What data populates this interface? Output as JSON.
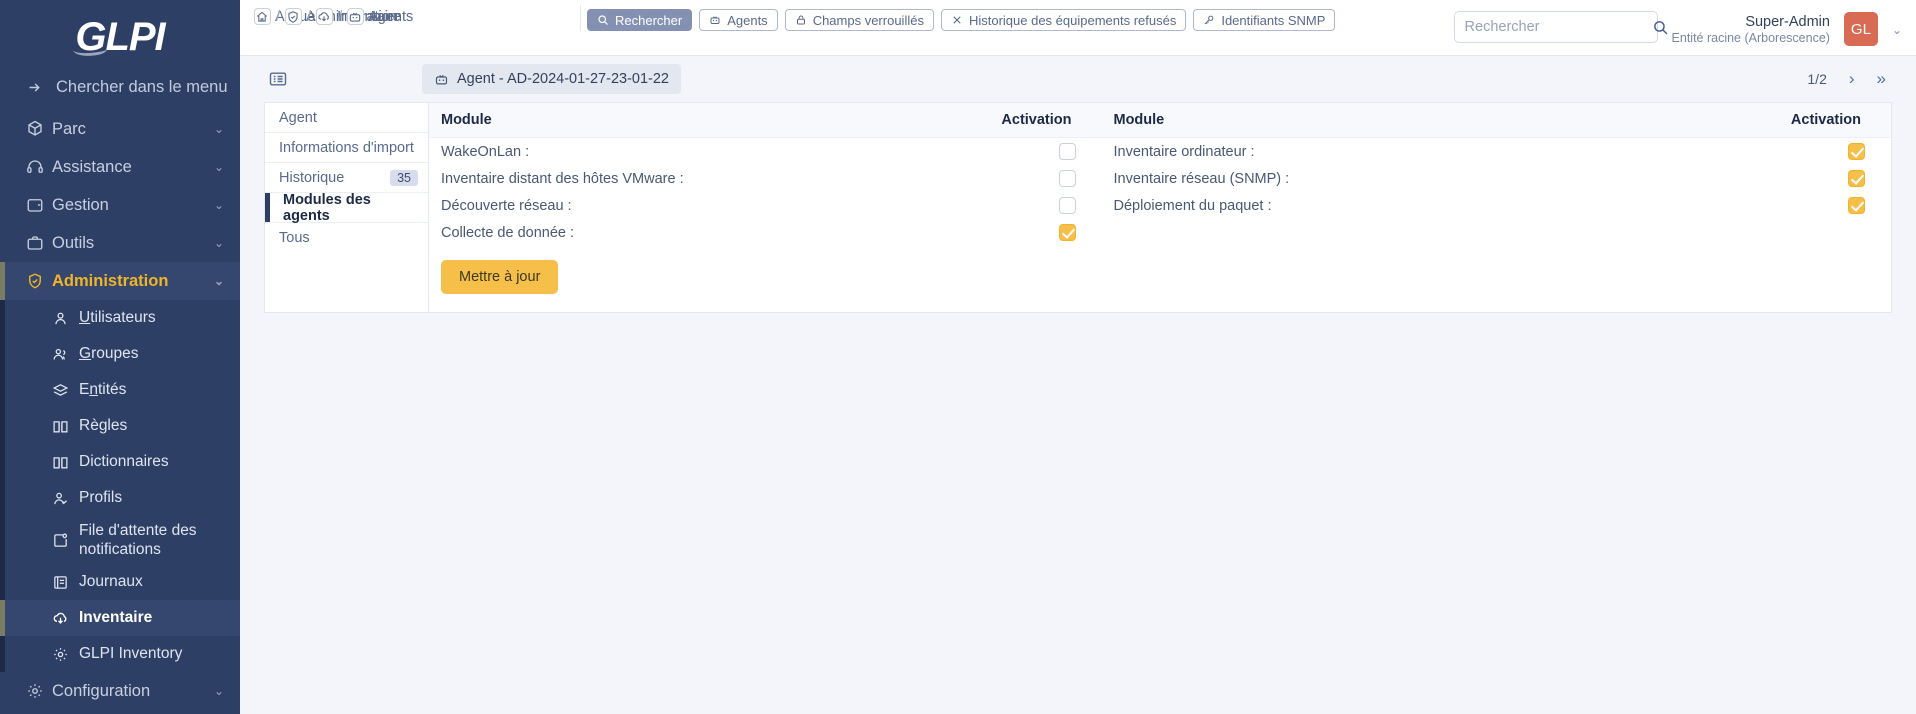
{
  "sidebar": {
    "logo": "GLPI",
    "menu_search_label": "Chercher dans le menu",
    "top_items": [
      {
        "label": "Parc",
        "icon": "box-icon"
      },
      {
        "label": "Assistance",
        "icon": "headset-icon"
      },
      {
        "label": "Gestion",
        "icon": "wallet-icon"
      },
      {
        "label": "Outils",
        "icon": "briefcase-icon"
      }
    ],
    "active_parent": {
      "label": "Administration",
      "icon": "shield-icon"
    },
    "sub_items": [
      {
        "label": "Utilisateurs",
        "accel": "U",
        "icon": "user-icon"
      },
      {
        "label": "Groupes",
        "accel": "G",
        "icon": "users-icon"
      },
      {
        "label": "Entités",
        "accel": "n",
        "icon": "layers-icon"
      },
      {
        "label": "Règles",
        "accel": "",
        "icon": "book-icon"
      },
      {
        "label": "Dictionnaires",
        "accel": "",
        "icon": "book-icon"
      },
      {
        "label": "Profils",
        "accel": "",
        "icon": "user-check-icon"
      },
      {
        "label": "File d'attente des notifications",
        "accel": "",
        "icon": "notification-icon"
      },
      {
        "label": "Journaux",
        "accel": "",
        "icon": "journal-icon"
      },
      {
        "label": "Inventaire",
        "accel": "",
        "icon": "cloud-download-icon",
        "current": true
      },
      {
        "label": "GLPI Inventory",
        "accel": "",
        "icon": "gear-icon"
      }
    ],
    "bottom_item": {
      "label": "Configuration",
      "icon": "gear-icon"
    }
  },
  "header": {
    "breadcrumb": [
      {
        "label": "Accueil",
        "icon": "home-icon"
      },
      {
        "label": "Administration",
        "icon": "shield-icon"
      },
      {
        "label": "Inventaire",
        "icon": "cloud-download-icon"
      },
      {
        "label": "Agents",
        "icon": "robot-icon"
      }
    ],
    "separator": "/",
    "pills": [
      {
        "label": "Rechercher",
        "icon": "search-icon",
        "active": true
      },
      {
        "label": "Agents",
        "icon": "robot-icon",
        "active": false
      },
      {
        "label": "Champs verrouillés",
        "icon": "lock-icon",
        "active": false
      },
      {
        "label": "Historique des équipements refusés",
        "icon": "close-icon",
        "active": false
      },
      {
        "label": "Identifiants SNMP",
        "icon": "key-icon",
        "active": false
      }
    ],
    "search": {
      "placeholder": "Rechercher",
      "value": ""
    },
    "user": {
      "name": "Super-Admin",
      "entity": "Entité racine (Arborescence)",
      "initials": "GL"
    }
  },
  "title_row": {
    "agent_label": "Agent - AD-2024-01-27-23-01-22",
    "pager": {
      "count": "1/2",
      "next": "›",
      "last": "»"
    }
  },
  "tabs": [
    {
      "label": "Agent",
      "badge": "",
      "active": false
    },
    {
      "label": "Informations d'import",
      "badge": "",
      "active": false
    },
    {
      "label": "Historique",
      "badge": "35",
      "active": false
    },
    {
      "label": "Modules des agents",
      "badge": "",
      "active": true
    },
    {
      "label": "Tous",
      "badge": "",
      "active": false
    }
  ],
  "modules_table": {
    "headers": {
      "module": "Module",
      "activation": "Activation"
    },
    "left_rows": [
      {
        "label": "WakeOnLan :",
        "checked": false
      },
      {
        "label": "Inventaire distant des hôtes VMware :",
        "checked": false
      },
      {
        "label": "Découverte réseau :",
        "checked": false
      },
      {
        "label": "Collecte de donnée :",
        "checked": true
      }
    ],
    "right_rows": [
      {
        "label": "Inventaire ordinateur :",
        "checked": true
      },
      {
        "label": "Inventaire réseau (SNMP) :",
        "checked": true
      },
      {
        "label": "Déploiement du paquet :",
        "checked": true
      },
      {
        "label": "",
        "checked": null
      }
    ],
    "update_button": "Mettre à jour"
  },
  "colors": {
    "sidebar_bg": "#2e3f65",
    "accent_amber": "#f6bf49",
    "avatar_red": "#d96a53",
    "pill_active": "#8491b3"
  }
}
